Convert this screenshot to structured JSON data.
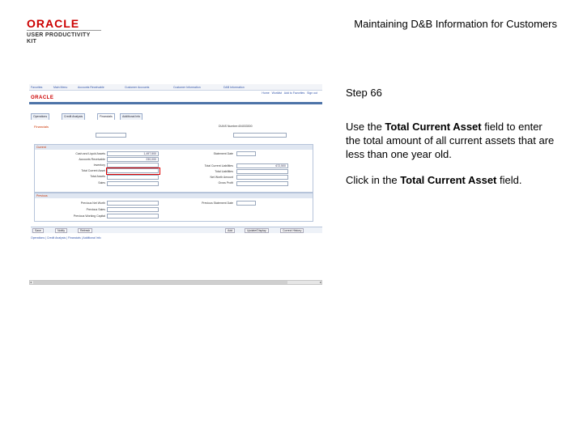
{
  "header": {
    "logo_oracle": "ORACLE",
    "logo_upk": "USER PRODUCTIVITY KIT",
    "doc_title": "Maintaining D&B Information for Customers"
  },
  "instructions": {
    "step": "Step 66",
    "para1_pre": "Use the ",
    "para1_bold": "Total Current Asset",
    "para1_post": " field to enter the total amount of all current assets that are less than one year old.",
    "para2_pre": "Click in the ",
    "para2_bold": "Total Current Asset",
    "para2_post": " field."
  },
  "screenshot": {
    "brand": "ORACLE",
    "tabs": [
      "Operations",
      "Credit Analysis",
      "Financials",
      "Additional Info"
    ],
    "section_current": "Current",
    "section_previous": "Previous",
    "labels": {
      "current_left": [
        "Cash and Liquid Assets",
        "Accounts Receivable",
        "Inventory",
        "Total Current Asset",
        "Total Assets",
        "Sales"
      ],
      "current_right": [
        "Statement Date",
        "Total Current Liabilities",
        "Total Liabilities",
        "Net Worth Amount",
        "Gross Profit"
      ],
      "previous_left": [
        "Previous Net Worth",
        "Previous Sales",
        "Previous Working Capital"
      ],
      "previous_right": [
        "Previous Statement Date"
      ]
    },
    "values": {
      "cash": "1,497,500",
      "receivable": "230,000",
      "current_liabilities": "672,500",
      "duns": "404033300"
    },
    "buttons_left": [
      "Save",
      "Notify",
      "Refresh"
    ],
    "buttons_right": [
      "Add",
      "Update/Display",
      "Correct History"
    ]
  }
}
